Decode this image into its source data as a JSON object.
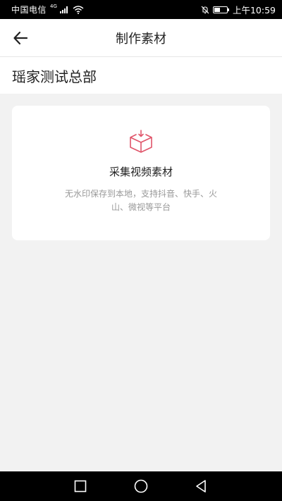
{
  "status_bar": {
    "carrier": "中国电信",
    "network_badge": "4G",
    "time": "上午10:59",
    "icons": [
      "signal-icon",
      "wifi-icon",
      "mute-icon",
      "battery-icon"
    ]
  },
  "app_bar": {
    "title": "制作素材",
    "back_icon": "arrow-left-icon"
  },
  "section": {
    "title": "瑶家测试总部"
  },
  "card": {
    "icon": "box-download-icon",
    "title": "采集视频素材",
    "description": "无水印保存到本地，支持抖音、快手、火山、微视等平台"
  },
  "nav_bar": {
    "icons": [
      "recent-apps-icon",
      "home-icon",
      "back-icon"
    ]
  },
  "colors": {
    "accent": "#e0556a",
    "background": "#f2f2f2",
    "card": "#ffffff",
    "muted_text": "#999999"
  }
}
